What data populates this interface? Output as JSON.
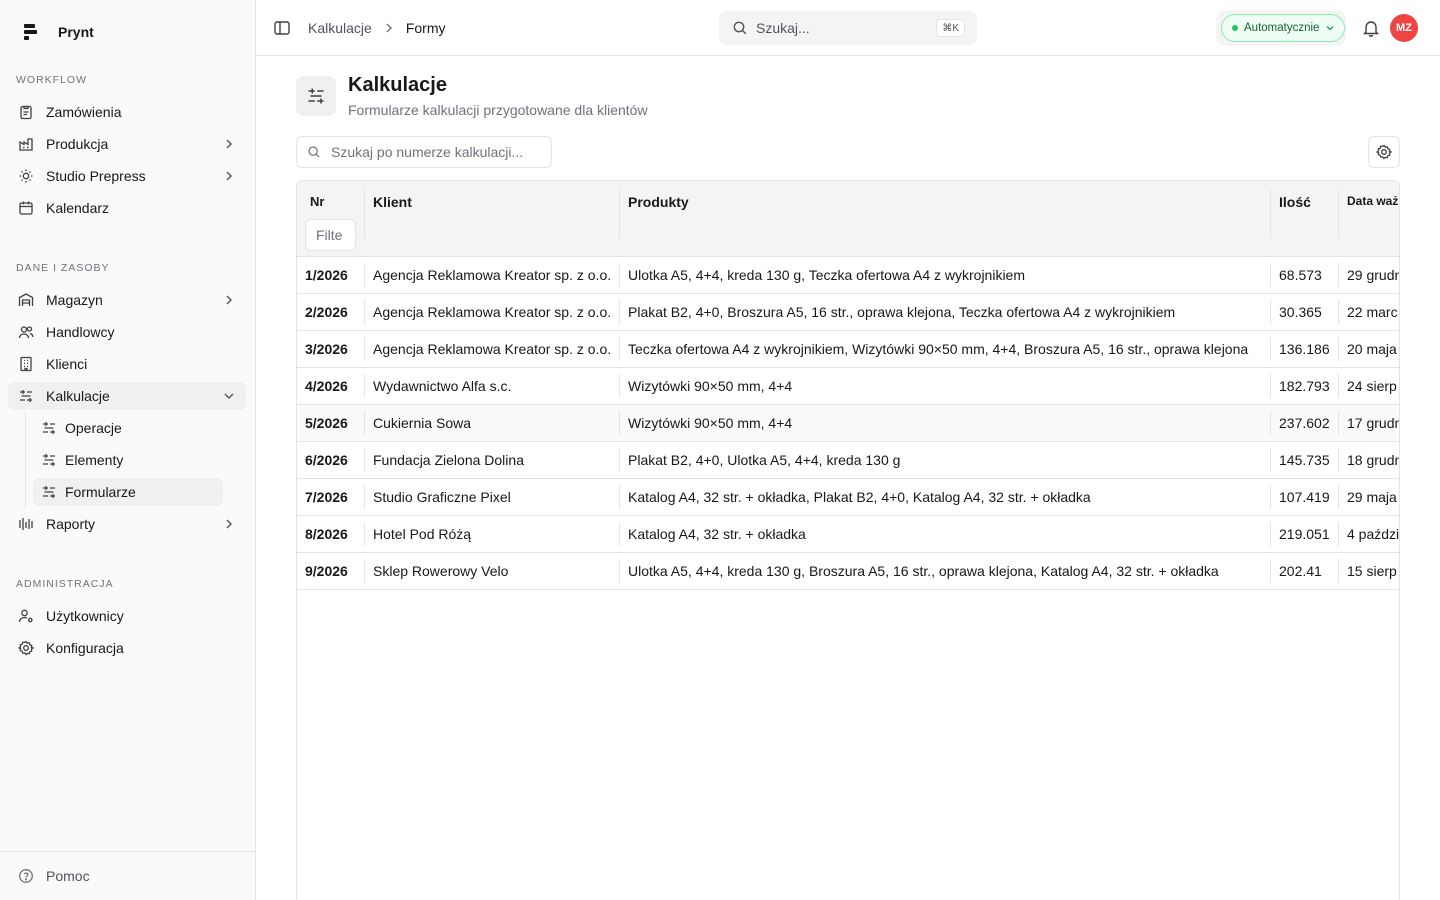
{
  "app": {
    "name": "Prynt"
  },
  "sidebar": {
    "sections": [
      {
        "title": "WORKFLOW"
      },
      {
        "title": "DANE I ZASOBY"
      },
      {
        "title": "ADMINISTRACJA"
      }
    ],
    "items": [
      {
        "label": "Zamówienia",
        "icon": "clipboard-icon"
      },
      {
        "label": "Produkcja",
        "icon": "factory-icon"
      },
      {
        "label": "Studio Prepress",
        "icon": "sun-icon"
      },
      {
        "label": "Kalendarz",
        "icon": "calendar-icon"
      },
      {
        "label": "Magazyn",
        "icon": "warehouse-icon"
      },
      {
        "label": "Handlowcy",
        "icon": "users-icon"
      },
      {
        "label": "Klienci",
        "icon": "building-icon"
      },
      {
        "label": "Kalkulacje",
        "icon": "sliders-icon"
      },
      {
        "label": "Raporty",
        "icon": "chart-icon"
      },
      {
        "label": "Użytkownicy",
        "icon": "user-gear-icon"
      },
      {
        "label": "Konfiguracja",
        "icon": "gear-icon"
      }
    ],
    "subitems": [
      {
        "label": "Operacje"
      },
      {
        "label": "Elementy"
      },
      {
        "label": "Formularze"
      }
    ],
    "help_label": "Pomoc"
  },
  "header": {
    "breadcrumb": {
      "parent": "Kalkulacje",
      "current": "Formy"
    },
    "search_placeholder": "Szukaj...",
    "search_shortcut": "⌘K",
    "mode_label": "Automatycznie",
    "avatar_initials": "MZ"
  },
  "page": {
    "title": "Kalkulacje",
    "subtitle": "Formularze kalkulacji przygotowane dla klientów",
    "search_placeholder": "Szukaj po numerze kalkulacji..."
  },
  "table": {
    "columns": [
      "Nr",
      "Klient",
      "Produkty",
      "Ilość",
      "Data waż"
    ],
    "filter_placeholder": "Filte",
    "rows": [
      {
        "nr": "1/2026",
        "client": "Agencja Reklamowa Kreator sp. z o.o.",
        "products": "Ulotka A5, 4+4, kreda 130 g, Teczka ofertowa A4 z wykrojnikiem",
        "qty": "68.573",
        "date": "29 grudn"
      },
      {
        "nr": "2/2026",
        "client": "Agencja Reklamowa Kreator sp. z o.o.",
        "products": "Plakat B2, 4+0, Broszura A5, 16 str., oprawa klejona, Teczka ofertowa A4 z wykrojnikiem",
        "qty": "30.365",
        "date": "22 marc"
      },
      {
        "nr": "3/2026",
        "client": "Agencja Reklamowa Kreator sp. z o.o.",
        "products": "Teczka ofertowa A4 z wykrojnikiem, Wizytówki 90×50 mm, 4+4, Broszura A5, 16 str., oprawa klejona",
        "qty": "136.186",
        "date": "20 maja"
      },
      {
        "nr": "4/2026",
        "client": "Wydawnictwo Alfa s.c.",
        "products": "Wizytówki 90×50 mm, 4+4",
        "qty": "182.793",
        "date": "24 sierp"
      },
      {
        "nr": "5/2026",
        "client": "Cukiernia Sowa",
        "products": "Wizytówki 90×50 mm, 4+4",
        "qty": "237.602",
        "date": "17 grudn"
      },
      {
        "nr": "6/2026",
        "client": "Fundacja Zielona Dolina",
        "products": "Plakat B2, 4+0, Ulotka A5, 4+4, kreda 130 g",
        "qty": "145.735",
        "date": "18 grudn"
      },
      {
        "nr": "7/2026",
        "client": "Studio Graficzne Pixel",
        "products": "Katalog A4, 32 str. + okładka, Plakat B2, 4+0, Katalog A4, 32 str. + okładka",
        "qty": "107.419",
        "date": "29 maja"
      },
      {
        "nr": "8/2026",
        "client": "Hotel Pod Różą",
        "products": "Katalog A4, 32 str. + okładka",
        "qty": "219.051",
        "date": "4 paździ"
      },
      {
        "nr": "9/2026",
        "client": "Sklep Rowerowy Velo",
        "products": "Ulotka A5, 4+4, kreda 130 g, Broszura A5, 16 str., oprawa klejona, Katalog A4, 32 str. + okładka",
        "qty": "202.41",
        "date": "15 sierp"
      }
    ]
  },
  "colors": {
    "accent_red": "#ef4444",
    "status_green": "#22c55e"
  }
}
